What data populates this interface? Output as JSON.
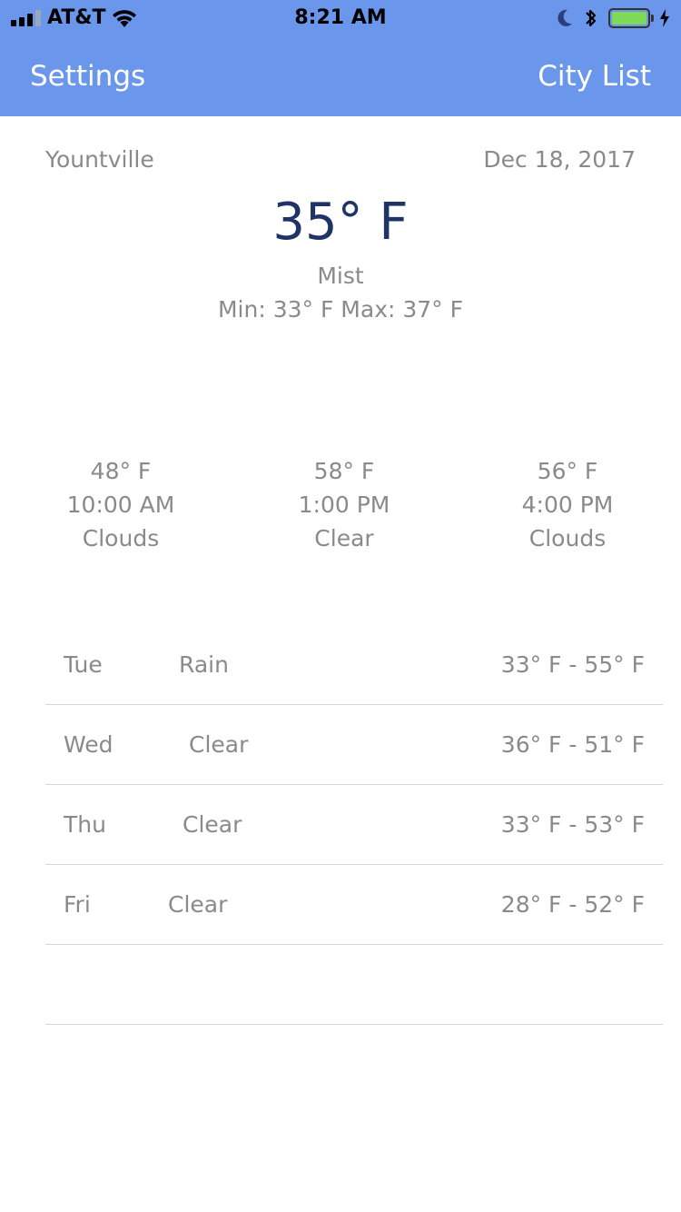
{
  "status_bar": {
    "carrier": "AT&T",
    "time": "8:21 AM",
    "signal_bars_active": 3,
    "signal_bars_total": 4,
    "battery_level": 1.0,
    "battery_color": "#7ed957"
  },
  "nav": {
    "background": "#6a96ec",
    "left_label": "Settings",
    "right_label": "City List"
  },
  "current": {
    "city": "Yountville",
    "date": "Dec 18, 2017",
    "temperature": "35° F",
    "condition": "Mist",
    "min_max": "Min: 33° F Max: 37° F"
  },
  "hourly": [
    {
      "temp": "48° F",
      "time": "10:00 AM",
      "condition": "Clouds"
    },
    {
      "temp": "58° F",
      "time": "1:00 PM",
      "condition": "Clear"
    },
    {
      "temp": "56° F",
      "time": "4:00 PM",
      "condition": "Clouds"
    }
  ],
  "daily": [
    {
      "day": "Tue",
      "condition": "Rain",
      "range": "33° F - 55° F"
    },
    {
      "day": "Wed",
      "condition": "Clear",
      "range": "36° F - 51° F"
    },
    {
      "day": "Thu",
      "condition": "Clear",
      "range": "33° F - 53° F"
    },
    {
      "day": "Fri",
      "condition": "Clear",
      "range": "28° F - 52° F"
    },
    {
      "day": "",
      "condition": "",
      "range": ""
    }
  ]
}
